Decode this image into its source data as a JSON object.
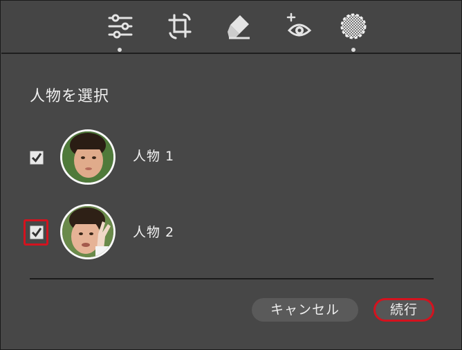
{
  "toolbar": {
    "tools": [
      {
        "icon": "sliders-icon",
        "active_dot": true
      },
      {
        "icon": "crop-rotate-icon",
        "active_dot": false
      },
      {
        "icon": "eraser-icon",
        "active_dot": false
      },
      {
        "icon": "red-eye-icon",
        "active_dot": false
      },
      {
        "icon": "mask-icon",
        "active_dot": true
      }
    ]
  },
  "dialog": {
    "title": "人物を選択",
    "people": [
      {
        "label": "人物 1",
        "checked": true
      },
      {
        "label": "人物 2",
        "checked": true,
        "highlighted": true
      }
    ],
    "cancel_label": "キャンセル",
    "continue_label": "続行"
  },
  "colors": {
    "background": "#474747",
    "highlight": "#d4121e",
    "text": "#f0f0f0"
  }
}
